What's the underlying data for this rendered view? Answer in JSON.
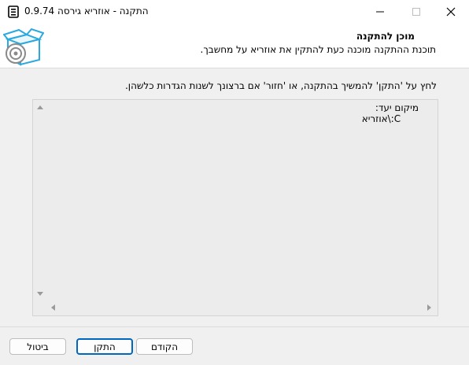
{
  "window": {
    "title": "התקנה - אוזריא גירסה 0.9.74"
  },
  "header": {
    "title": "מוכן להתקנה",
    "subtitle": "תוכנת ההתקנה מוכנה כעת להתקין את אוזריא על מחשבך."
  },
  "instruction": "לחץ על 'התקן' להמשיך בהתקנה, או 'חזור' אם ברצונך לשנות הגדרות כלשהן.",
  "memo": {
    "text": "מיקום יעד:\n      C:\\אוזריא"
  },
  "buttons": {
    "back": "הקודם",
    "install": "התקן",
    "cancel": "ביטול"
  },
  "colors": {
    "accent": "#0067c0",
    "memo_background": "#ececec",
    "dialog_background": "#f0f0f0"
  }
}
